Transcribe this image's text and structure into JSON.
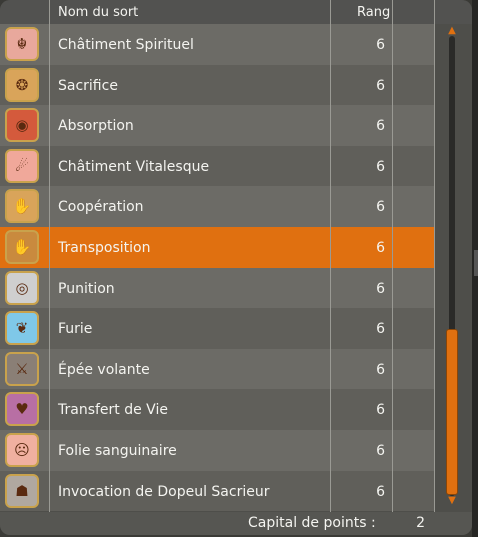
{
  "table": {
    "headers": {
      "name": "Nom du sort",
      "rank": "Rang"
    },
    "rows": [
      {
        "name": "Châtiment Spirituel",
        "rank": "6",
        "icon": "spirit-punishment-icon",
        "color": "#e8a89c",
        "selected": false
      },
      {
        "name": "Sacrifice",
        "rank": "6",
        "icon": "sacrifice-icon",
        "color": "#d9a45a",
        "selected": false
      },
      {
        "name": "Absorption",
        "rank": "6",
        "icon": "absorption-icon",
        "color": "#d45a3c",
        "selected": false
      },
      {
        "name": "Châtiment Vitalesque",
        "rank": "6",
        "icon": "vitality-punishment-icon",
        "color": "#f0a89a",
        "selected": false
      },
      {
        "name": "Coopération",
        "rank": "6",
        "icon": "cooperation-hand-icon",
        "color": "#d9a45a",
        "selected": false
      },
      {
        "name": "Transposition",
        "rank": "6",
        "icon": "transposition-hand-icon",
        "color": "#c98a3e",
        "selected": true
      },
      {
        "name": "Punition",
        "rank": "6",
        "icon": "eye-punishment-icon",
        "color": "#cfcfcf",
        "selected": false
      },
      {
        "name": "Furie",
        "rank": "6",
        "icon": "fury-wings-icon",
        "color": "#7fc8e8",
        "selected": false
      },
      {
        "name": "Épée volante",
        "rank": "6",
        "icon": "flying-sword-icon",
        "color": "#8a7f76",
        "selected": false
      },
      {
        "name": "Transfert de Vie",
        "rank": "6",
        "icon": "heart-transfer-icon",
        "color": "#b86fa4",
        "selected": false
      },
      {
        "name": "Folie sanguinaire",
        "rank": "6",
        "icon": "blood-madness-face-icon",
        "color": "#f0b0a0",
        "selected": false
      },
      {
        "name": "Invocation de Dopeul Sacrieur",
        "rank": "6",
        "icon": "dopple-summon-icon",
        "color": "#b0a8a0",
        "selected": false
      }
    ]
  },
  "footer": {
    "label": "Capital de points :",
    "value": "2"
  },
  "colors": {
    "accent": "#e07010",
    "row_odd": "#6c6b66",
    "row_even": "#605f5a"
  },
  "scroll": {
    "position": 0.7
  }
}
